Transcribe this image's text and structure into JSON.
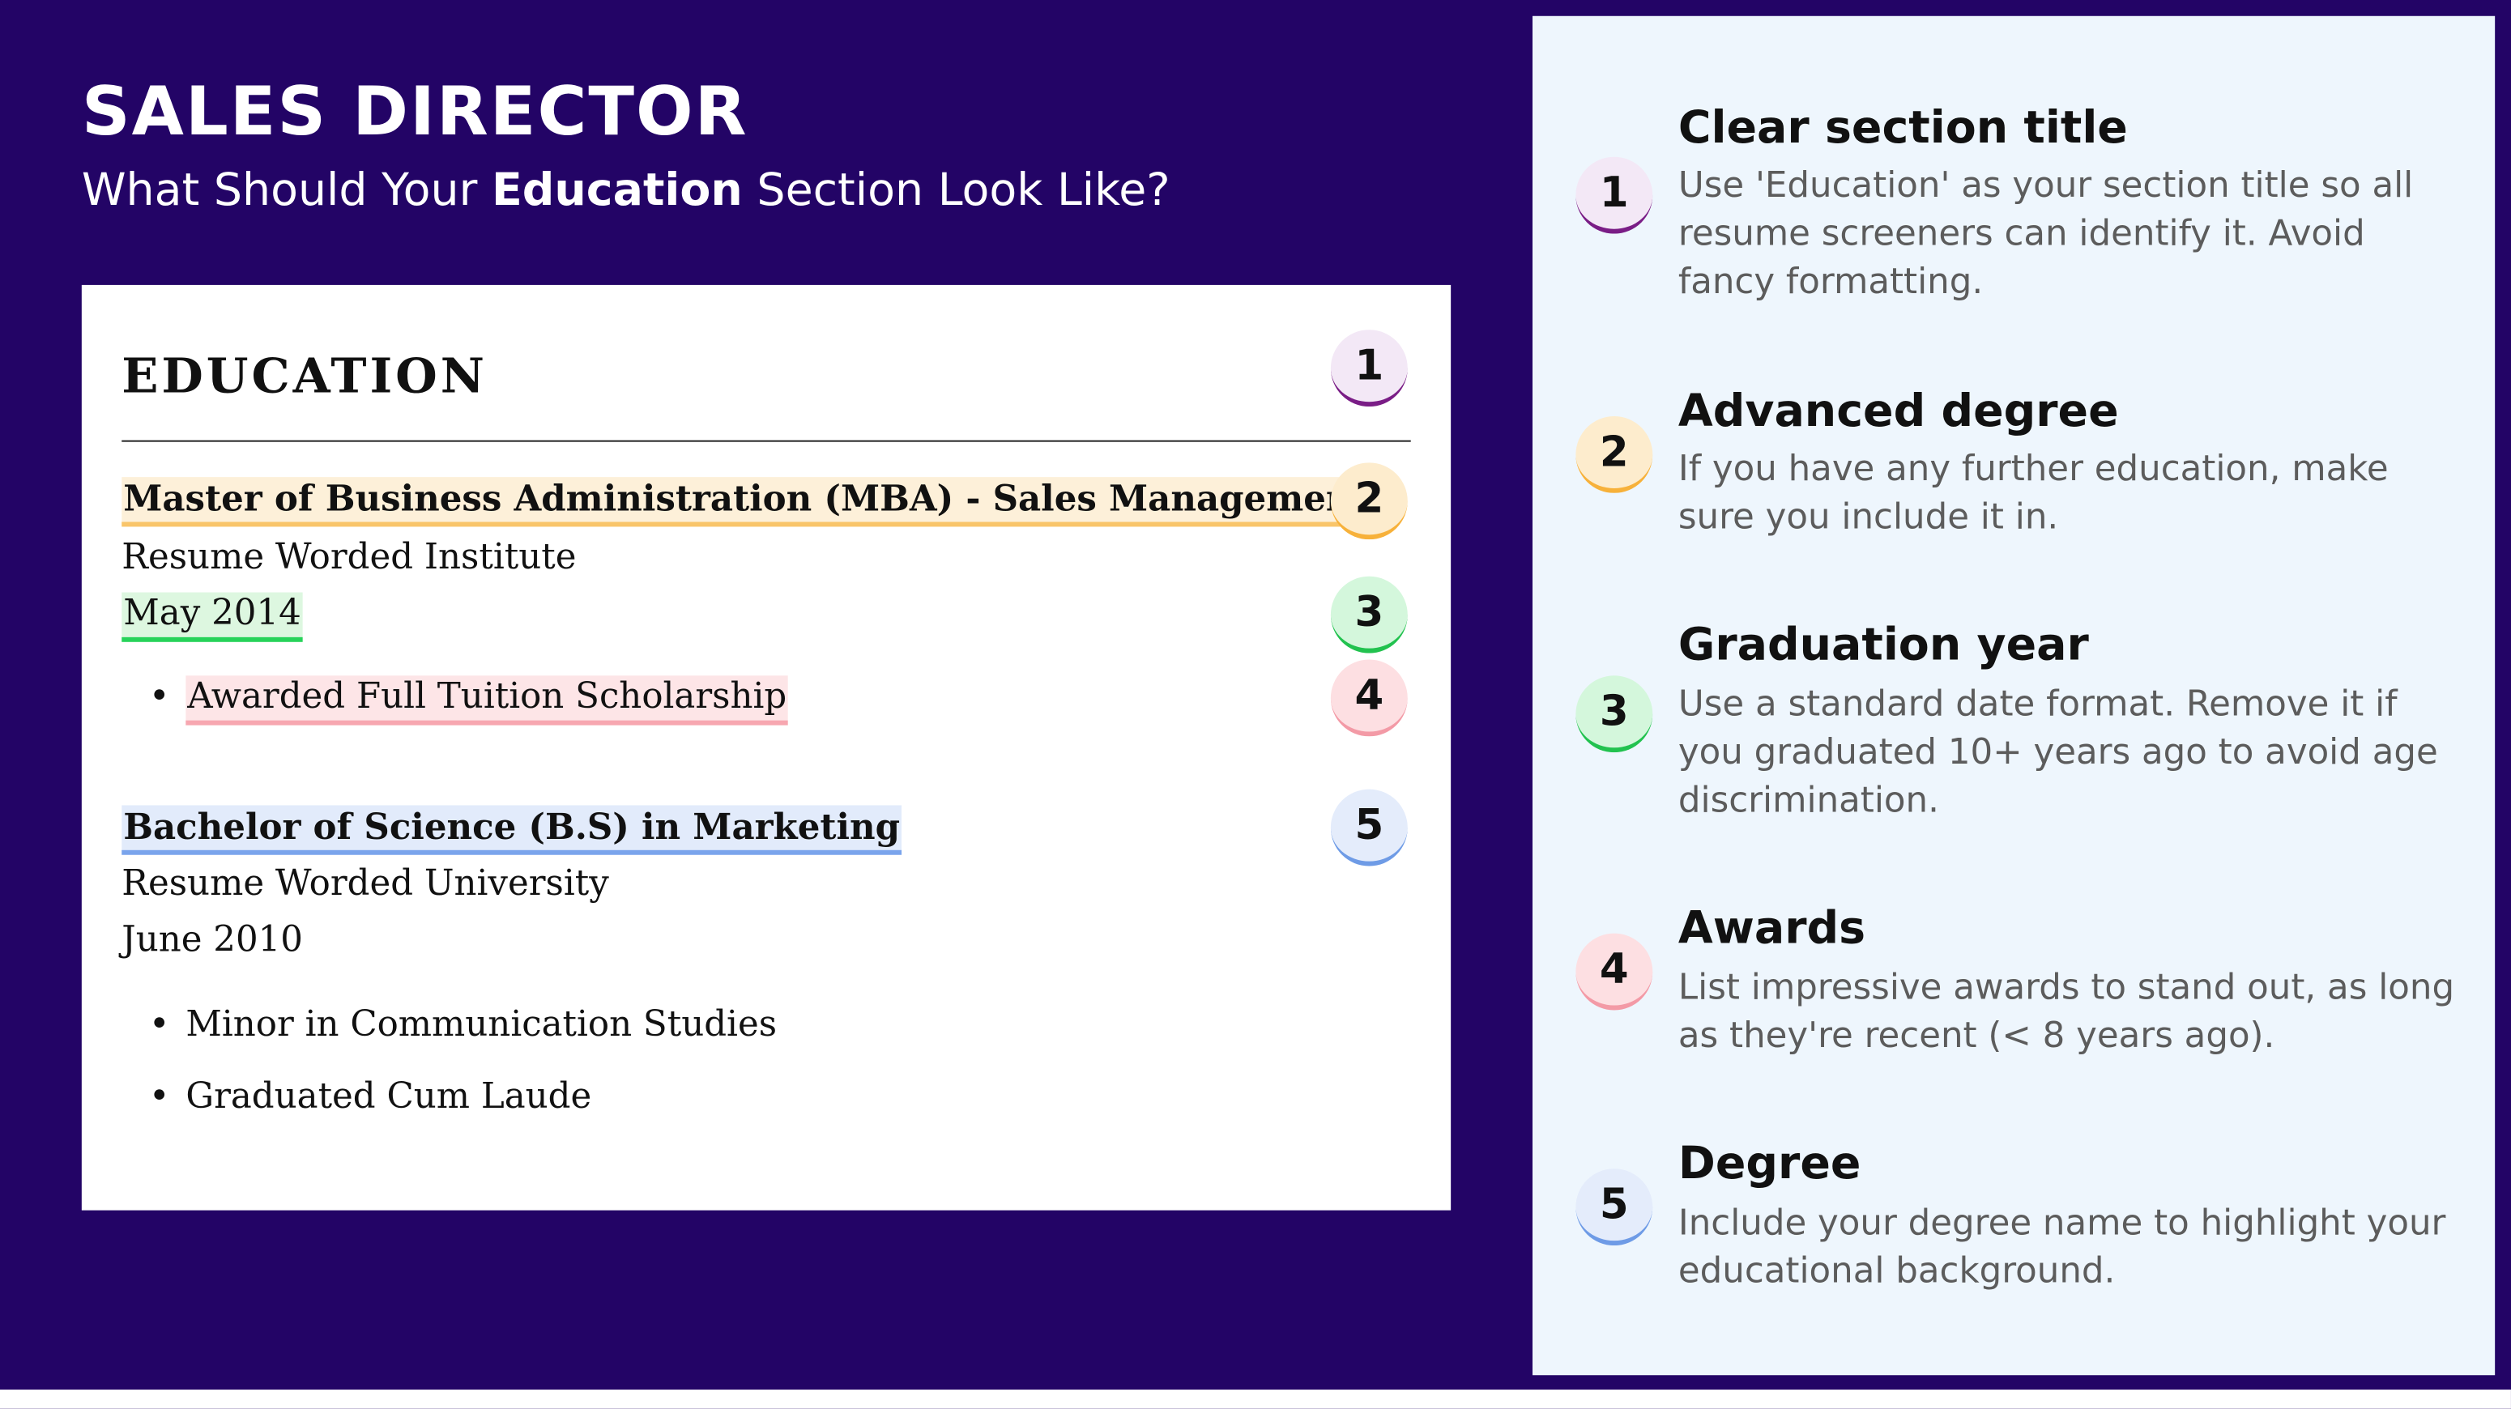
{
  "header": {
    "title": "SALES DIRECTOR",
    "subtitle_before": "What Should Your ",
    "subtitle_bold": "Education",
    "subtitle_after": " Section Look Like?"
  },
  "resume": {
    "section_heading": "EDUCATION",
    "entries": [
      {
        "degree": "Master of Business Administration (MBA) - Sales Management",
        "school": "Resume Worded Institute",
        "date": "May 2014",
        "bullets": [
          "Awarded Full Tuition Scholarship"
        ]
      },
      {
        "degree": "Bachelor of Science (B.S) in Marketing",
        "school": "Resume Worded University",
        "date": "June 2010",
        "bullets": [
          "Minor in Communication Studies",
          "Graduated Cum Laude"
        ]
      }
    ],
    "badges": [
      "1",
      "2",
      "3",
      "4",
      "5"
    ]
  },
  "tips": [
    {
      "number": "1",
      "title": "Clear section title",
      "description": "Use 'Education' as your section title so all resume screeners can identify it. Avoid fancy formatting."
    },
    {
      "number": "2",
      "title": "Advanced degree",
      "description": "If you have any further education, make sure you include it in."
    },
    {
      "number": "3",
      "title": "Graduation year",
      "description": "Use a standard date format. Remove it if you graduated 10+ years ago to avoid age discrimination."
    },
    {
      "number": "4",
      "title": "Awards",
      "description": "List impressive awards to stand out, as long as they're recent (< 8 years ago)."
    },
    {
      "number": "5",
      "title": "Degree",
      "description": "Include your degree name to highlight your educational background."
    }
  ],
  "colors": {
    "background": "#230466",
    "panel": "#eef6fd",
    "badge_1": "#7a1d86",
    "badge_2": "#f7b13a",
    "badge_3": "#22c24f",
    "badge_4": "#f39aa6",
    "badge_5": "#6e9be6"
  }
}
